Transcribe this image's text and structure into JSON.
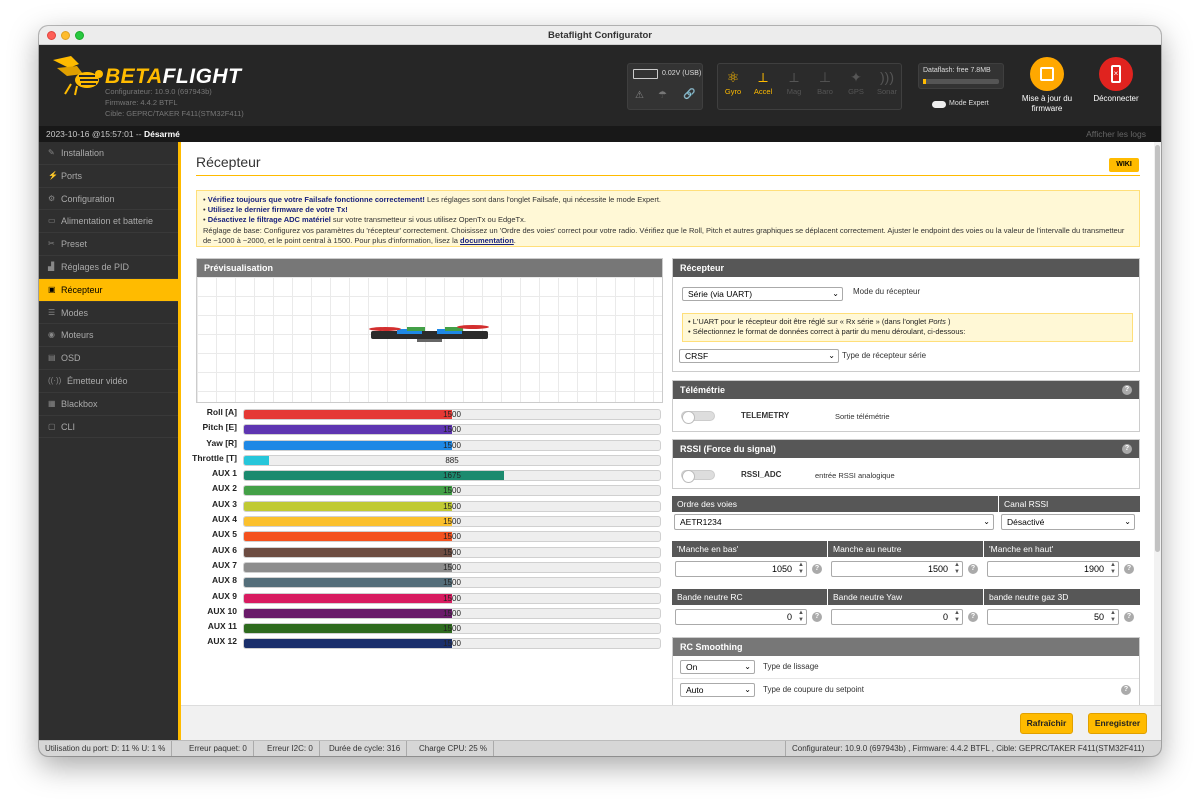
{
  "window": {
    "title": "Betaflight Configurator"
  },
  "header": {
    "logo_prefix": "BETA",
    "logo_suffix": "FLIGHT",
    "configurator": "Configurateur: 10.9.0 (697943b)",
    "firmware": "Firmware: 4.4.2 BTFL",
    "target": "Cible: GEPRC/TAKER F411(STM32F411)",
    "battery": "0.02V (USB)",
    "sensors": [
      "Gyro",
      "Accel",
      "Mag",
      "Baro",
      "GPS",
      "Sonar"
    ],
    "dataflash": "Dataflash: free 7.8MB",
    "expert_mode": "Mode Expert",
    "update_firmware": "Mise à jour du firmware",
    "disconnect": "Déconnecter"
  },
  "statebar": {
    "datetime": "2023-10-16 @15:57:01 -- ",
    "state": "Désarmé",
    "show_logs": "Afficher les logs"
  },
  "sidebar": {
    "items": [
      {
        "label": "Installation",
        "icon": "wrench-icon"
      },
      {
        "label": "Ports",
        "icon": "plug-icon"
      },
      {
        "label": "Configuration",
        "icon": "gear-icon"
      },
      {
        "label": "Alimentation et batterie",
        "icon": "battery-icon"
      },
      {
        "label": "Preset",
        "icon": "preset-icon"
      },
      {
        "label": "Réglages de PID",
        "icon": "pid-icon"
      },
      {
        "label": "Récepteur",
        "icon": "receiver-icon"
      },
      {
        "label": "Modes",
        "icon": "modes-icon"
      },
      {
        "label": "Moteurs",
        "icon": "motor-icon"
      },
      {
        "label": "OSD",
        "icon": "osd-icon"
      },
      {
        "label": "Émetteur vidéo",
        "icon": "vtx-icon"
      },
      {
        "label": "Blackbox",
        "icon": "blackbox-icon"
      },
      {
        "label": "CLI",
        "icon": "cli-icon"
      }
    ]
  },
  "page": {
    "title": "Récepteur",
    "wiki": "WIKI",
    "note": {
      "l1_b": "Vérifiez toujours que votre Failsafe fonctionne correctement!",
      "l1": " Les réglages sont dans l'onglet Failsafe, qui nécessite le mode Expert.",
      "l2_b": "Utilisez le dernier firmware de votre Tx!",
      "l3_b": "Désactivez le filtrage ADC matériel",
      "l3": " sur votre transmetteur si vous utilisez OpenTx ou EdgeTx.",
      "l4": "Réglage de base: Configurez vos paramètres du 'récepteur' correctement. Choisissez un 'Ordre des voies' correct pour votre radio. Vérifiez que le Roll, Pitch et autres graphiques se déplacent correctement. Ajuster le endpoint des voies ou la valeur de l'intervalle du transmetteur de ~1000 à ~2000, et le point central à 1500. Pour plus d'information, lisez la ",
      "l4_link": "documentation",
      "l4_end": "."
    },
    "preview_title": "Prévisualisation",
    "channels": [
      {
        "label": "Roll [A]",
        "value": 1500,
        "color": "#e53935"
      },
      {
        "label": "Pitch [E]",
        "value": 1500,
        "color": "#5e35b1"
      },
      {
        "label": "Yaw [R]",
        "value": 1500,
        "color": "#1e88e5"
      },
      {
        "label": "Throttle [T]",
        "value": 885,
        "color": "#26c6da"
      },
      {
        "label": "AUX 1",
        "value": 1675,
        "color": "#1b8a6e"
      },
      {
        "label": "AUX 2",
        "value": 1500,
        "color": "#43a047"
      },
      {
        "label": "AUX 3",
        "value": 1500,
        "color": "#c0ca33"
      },
      {
        "label": "AUX 4",
        "value": 1500,
        "color": "#fbc02d"
      },
      {
        "label": "AUX 5",
        "value": 1500,
        "color": "#f4511e"
      },
      {
        "label": "AUX 6",
        "value": 1500,
        "color": "#6d4c41"
      },
      {
        "label": "AUX 7",
        "value": 1500,
        "color": "#8d8d8d"
      },
      {
        "label": "AUX 8",
        "value": 1500,
        "color": "#546e7a"
      },
      {
        "label": "AUX 9",
        "value": 1500,
        "color": "#d81b60"
      },
      {
        "label": "AUX 10",
        "value": 1500,
        "color": "#6a1b6a"
      },
      {
        "label": "AUX 11",
        "value": 1500,
        "color": "#2e6b1e"
      },
      {
        "label": "AUX 12",
        "value": 1500,
        "color": "#1a2f6b"
      }
    ],
    "receiver": {
      "title": "Récepteur",
      "mode": "Série (via UART)",
      "mode_label": "Mode du récepteur",
      "info1_a": "• L'UART pour le récepteur doit être réglé sur « Rx série » (dans l'onglet ",
      "info1_b": "Ports",
      "info1_c": " )",
      "info2": "• Sélectionnez le format de données correct à partir du menu déroulant, ci-dessous:",
      "serial_type": "CRSF",
      "serial_type_label": "Type de récepteur série"
    },
    "telemetry": {
      "title": "Télémétrie",
      "switch": "TELEMETRY",
      "desc": "Sortie télémétrie"
    },
    "rssi": {
      "title": "RSSI (Force du signal)",
      "switch": "RSSI_ADC",
      "desc": "entrée RSSI analogique"
    },
    "channel_map": {
      "title": "Ordre des voies",
      "value": "AETR1234",
      "rssi_title": "Canal RSSI",
      "rssi_value": "Désactivé"
    },
    "sticks": {
      "low_t": "'Manche en bas'",
      "low": "1050",
      "center_t": "Manche au neutre",
      "center": "1500",
      "high_t": "'Manche en haut'",
      "high": "1900"
    },
    "deadband": {
      "rc_t": "Bande neutre RC",
      "rc": "0",
      "yaw_t": "Bande neutre Yaw",
      "yaw": "0",
      "thr_t": "bande neutre gaz 3D",
      "thr": "50"
    },
    "smoothing": {
      "title": "RC Smoothing",
      "type": "On",
      "type_label": "Type de lissage",
      "cutoff": "Auto",
      "cutoff_label": "Type de coupure du setpoint"
    },
    "buttons": {
      "refresh": "Rafraîchir",
      "save": "Enregistrer"
    }
  },
  "statusbar": {
    "port": "Utilisation du port: D: 11 % U: 1 %",
    "packet": "Erreur paquet: 0",
    "i2c": "Erreur I2C: 0",
    "cycle": "Durée de cycle: 316",
    "cpu": "Charge CPU: 25 %",
    "version": "Configurateur: 10.9.0 (697943b) , Firmware: 4.4.2 BTFL , Cible: GEPRC/TAKER F411(STM32F411)"
  },
  "colors": {
    "accent": "#ffbb00",
    "update_button": "#ffa800",
    "disconnect_button": "#e0231f"
  }
}
